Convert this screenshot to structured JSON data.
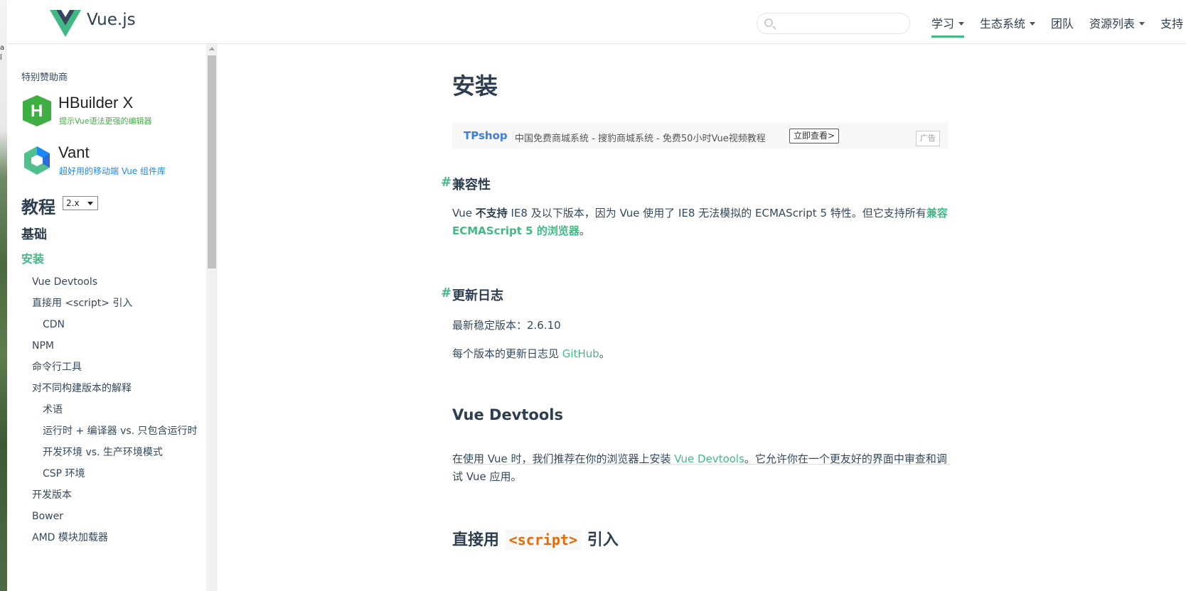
{
  "header": {
    "brand": "Vue.js",
    "search_placeholder": "",
    "nav": [
      {
        "label": "学习",
        "dropdown": true,
        "active": true
      },
      {
        "label": "生态系统",
        "dropdown": true
      },
      {
        "label": "团队",
        "dropdown": false
      },
      {
        "label": "资源列表",
        "dropdown": true
      },
      {
        "label": "支持 Vue",
        "dropdown": true
      }
    ]
  },
  "sidebar": {
    "sponsor_label": "特别赞助商",
    "sponsors": [
      {
        "name": "HBuilder X",
        "tagline": "提示Vue语法更强的编辑器"
      },
      {
        "name": "Vant",
        "tagline": "超好用的移动端 Vue 组件库"
      }
    ],
    "tutorial_title": "教程",
    "version": "2.x",
    "section_title": "基础",
    "menu": [
      {
        "label": "安装",
        "level": 0
      },
      {
        "label": "Vue Devtools",
        "level": 1
      },
      {
        "label": "直接用 <script> 引入",
        "level": 1
      },
      {
        "label": "CDN",
        "level": 2
      },
      {
        "label": "NPM",
        "level": 1
      },
      {
        "label": "命令行工具",
        "level": 1
      },
      {
        "label": "对不同构建版本的解释",
        "level": 1
      },
      {
        "label": "术语",
        "level": 2
      },
      {
        "label": "运行时 + 编译器 vs. 只包含运行时",
        "level": 2
      },
      {
        "label": "开发环境 vs. 生产环境模式",
        "level": 2
      },
      {
        "label": "CSP 环境",
        "level": 2
      },
      {
        "label": "开发版本",
        "level": 1
      },
      {
        "label": "Bower",
        "level": 1
      },
      {
        "label": "AMD 模块加载器",
        "level": 1
      }
    ]
  },
  "content": {
    "title": "安装",
    "ad": {
      "brand": "TPshop",
      "description": "中国免费商城系统 - 搜豹商城系统 - 免费50小时Vue视频教程",
      "button": "立即查看>",
      "tag": "广告"
    },
    "compat": {
      "heading": "兼容性",
      "p_prefix": "Vue ",
      "p_bold": "不支持",
      "p_mid": " IE8 及以下版本，因为 Vue 使用了 IE8 无法模拟的 ECMAScript 5 特性。但它支持所有",
      "p_link": "兼容 ECMAScript 5 的浏览器",
      "p_suffix": "。"
    },
    "changelog": {
      "heading": "更新日志",
      "stable_label": "最新稳定版本：2.6.10",
      "p_prefix": "每个版本的更新日志见 ",
      "p_link": "GitHub",
      "p_suffix": "。"
    },
    "devtools": {
      "heading": "Vue Devtools",
      "p_prefix": "在使用 Vue 时，我们推荐在你的浏览器上安装 ",
      "p_link": "Vue Devtools",
      "p_suffix": "。它允许你在一个更友好的界面中审查和调试 Vue 应用。"
    },
    "script": {
      "heading_prefix": "直接用",
      "heading_code": "<script>",
      "heading_suffix": "引入"
    }
  }
}
